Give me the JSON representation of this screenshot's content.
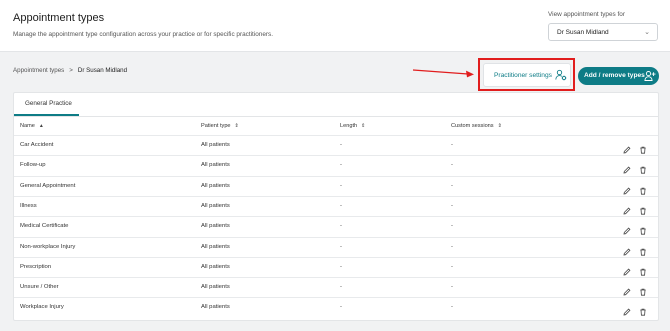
{
  "header": {
    "title": "Appointment types",
    "subtitle": "Manage the appointment type configuration across your practice or for specific practitioners.",
    "view_label": "View appointment types for",
    "view_value": "Dr Susan Midland"
  },
  "breadcrumb": {
    "root": "Appointment types",
    "separator": ">",
    "current": "Dr Susan Midland"
  },
  "actions": {
    "settings_label": "Practitioner settings",
    "add_label": "Add / remove types"
  },
  "annotation": {
    "color": "#e11d1d"
  },
  "colors": {
    "accent": "#0e7c86"
  },
  "tabs": [
    {
      "label": "General Practice"
    }
  ],
  "table": {
    "columns": [
      "Name",
      "Patient type",
      "Length",
      "Custom sessions"
    ],
    "rows": [
      {
        "name": "Car Accident",
        "patient_type": "All patients",
        "length": "-",
        "custom_sessions": "-"
      },
      {
        "name": "Follow-up",
        "patient_type": "All patients",
        "length": "-",
        "custom_sessions": "-"
      },
      {
        "name": "General Appointment",
        "patient_type": "All patients",
        "length": "-",
        "custom_sessions": "-"
      },
      {
        "name": "Illness",
        "patient_type": "All patients",
        "length": "-",
        "custom_sessions": "-"
      },
      {
        "name": "Medical Certificate",
        "patient_type": "All patients",
        "length": "-",
        "custom_sessions": "-"
      },
      {
        "name": "Non-workplace Injury",
        "patient_type": "All patients",
        "length": "-",
        "custom_sessions": "-"
      },
      {
        "name": "Prescription",
        "patient_type": "All patients",
        "length": "-",
        "custom_sessions": "-"
      },
      {
        "name": "Unsure / Other",
        "patient_type": "All patients",
        "length": "-",
        "custom_sessions": "-"
      },
      {
        "name": "Workplace Injury",
        "patient_type": "All patients",
        "length": "-",
        "custom_sessions": "-"
      }
    ]
  }
}
